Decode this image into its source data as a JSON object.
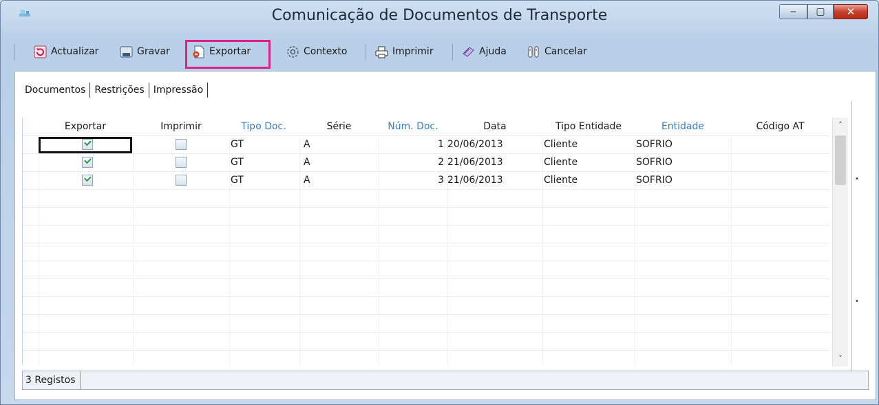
{
  "window": {
    "title": "Comunicação de Documentos de Transporte",
    "controls": {
      "minimize": "‒",
      "maximize": "▢",
      "close": "✕"
    }
  },
  "toolbar": {
    "items": [
      {
        "label": "Actualizar",
        "icon": "refresh-icon"
      },
      {
        "label": "Gravar",
        "icon": "save-icon"
      },
      {
        "label": "Exportar",
        "icon": "export-icon"
      },
      {
        "label": "Contexto",
        "icon": "context-icon"
      },
      {
        "label": "Imprimir",
        "icon": "printer-icon"
      },
      {
        "label": "Ajuda",
        "icon": "help-icon"
      },
      {
        "label": "Cancelar",
        "icon": "cancel-icon"
      }
    ],
    "highlight_color": "#e0208a"
  },
  "tabs": [
    "Documentos",
    "Restrições",
    "Impressão"
  ],
  "grid": {
    "columns": [
      "Exportar",
      "Imprimir",
      "Tipo Doc.",
      "Série",
      "Núm. Doc.",
      "Data",
      "Tipo Entidade",
      "Entidade",
      "Código AT"
    ],
    "link_column_color": "#3c7cc4",
    "rows": [
      {
        "exportar": true,
        "imprimir": false,
        "tipo_doc": "GT",
        "serie": "A",
        "num_doc": "1",
        "data": "20/06/2013",
        "tipo_entidade": "Cliente",
        "entidade": "SOFRIO",
        "codigo_at": ""
      },
      {
        "exportar": true,
        "imprimir": false,
        "tipo_doc": "GT",
        "serie": "A",
        "num_doc": "2",
        "data": "21/06/2013",
        "tipo_entidade": "Cliente",
        "entidade": "SOFRIO",
        "codigo_at": ""
      },
      {
        "exportar": true,
        "imprimir": false,
        "tipo_doc": "GT",
        "serie": "A",
        "num_doc": "3",
        "data": "21/06/2013",
        "tipo_entidade": "Cliente",
        "entidade": "SOFRIO",
        "codigo_at": ""
      }
    ]
  },
  "scroll": {
    "up": "˄",
    "down": "˅"
  },
  "status": {
    "text": "3 Registos"
  }
}
